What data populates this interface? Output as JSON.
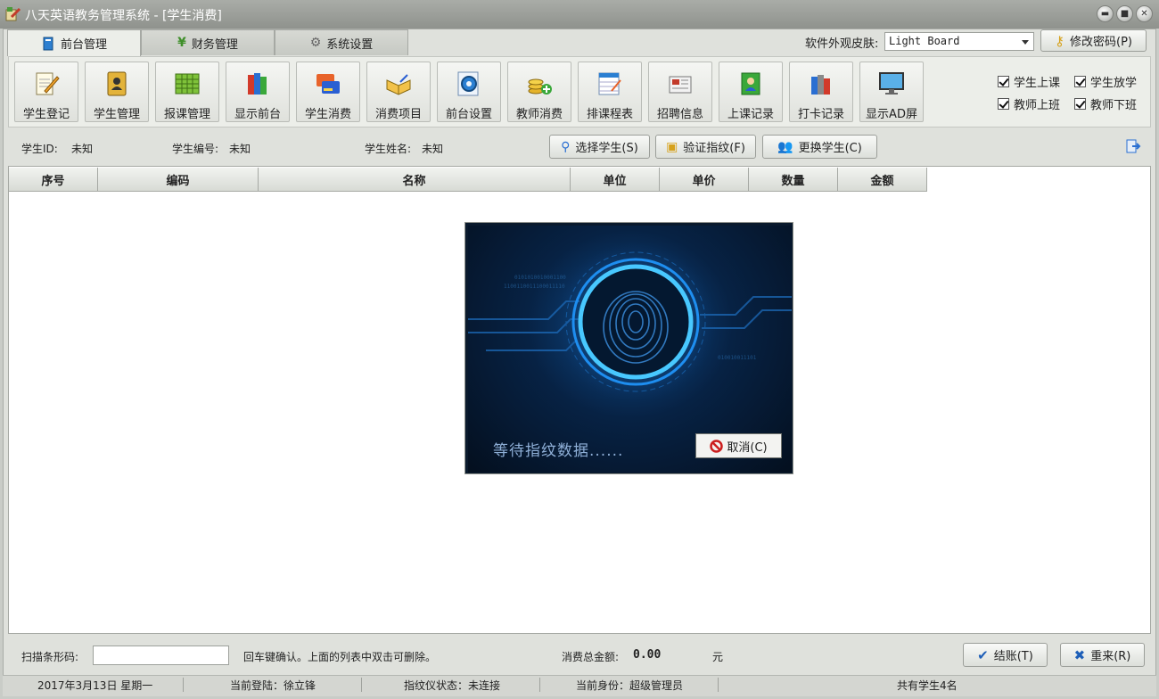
{
  "window": {
    "title": "八天英语教务管理系统 - [学生消费]"
  },
  "tabs": [
    {
      "label": "前台管理",
      "icon": "book-icon",
      "active": true
    },
    {
      "label": "财务管理",
      "icon": "yen-icon",
      "active": false
    },
    {
      "label": "系统设置",
      "icon": "gear-icon",
      "active": false
    }
  ],
  "skin": {
    "label": "软件外观皮肤:",
    "value": "Light Board"
  },
  "change_password": {
    "label": "修改密码(P)"
  },
  "toolbar": [
    {
      "label": "学生登记",
      "icon": "notepad-pencil-icon"
    },
    {
      "label": "学生管理",
      "icon": "contact-book-icon"
    },
    {
      "label": "报课管理",
      "icon": "spreadsheet-icon"
    },
    {
      "label": "显示前台",
      "icon": "books-icon"
    },
    {
      "label": "学生消费",
      "icon": "credit-card-icon"
    },
    {
      "label": "消费项目",
      "icon": "open-book-icon"
    },
    {
      "label": "前台设置",
      "icon": "settings-gear-icon"
    },
    {
      "label": "教师消费",
      "icon": "coins-add-icon"
    },
    {
      "label": "排课程表",
      "icon": "schedule-icon"
    },
    {
      "label": "招聘信息",
      "icon": "newspaper-icon"
    },
    {
      "label": "上课记录",
      "icon": "class-record-icon"
    },
    {
      "label": "打卡记录",
      "icon": "punch-books-icon"
    },
    {
      "label": "显示AD屏",
      "icon": "monitor-icon"
    }
  ],
  "checkboxes": [
    {
      "label": "学生上课",
      "checked": true
    },
    {
      "label": "学生放学",
      "checked": true
    },
    {
      "label": "教师上班",
      "checked": true
    },
    {
      "label": "教师下班",
      "checked": true
    }
  ],
  "student_info": {
    "id_label": "学生ID:",
    "id_value": "未知",
    "no_label": "学生编号:",
    "no_value": "未知",
    "name_label": "学生姓名:",
    "name_value": "未知"
  },
  "actions": {
    "select_student": "选择学生(S)",
    "verify_fingerprint": "验证指纹(F)",
    "change_student": "更换学生(C)"
  },
  "table": {
    "headers": [
      "序号",
      "编码",
      "名称",
      "单位",
      "单价",
      "数量",
      "金额"
    ],
    "rows": []
  },
  "fingerprint_dialog": {
    "message": "等待指纹数据......",
    "cancel_label": "取消(C)"
  },
  "footer": {
    "scan_label": "扫描条形码:",
    "scan_value": "",
    "hint": "回车键确认。上面的列表中双击可删除。",
    "total_label": "消费总金额:",
    "total_value": "0.00",
    "currency": "元",
    "checkout_label": "结账(T)",
    "reset_label": "重来(R)"
  },
  "status": {
    "date": "2017年3月13日 星期一",
    "login": "当前登陆：徐立锋",
    "device": "指纹仪状态：未连接",
    "identity": "当前身份：超级管理员",
    "count": "共有学生4名"
  },
  "colors": {
    "accent_blue": "#1e7bd6",
    "fingerprint_bg": "#072244",
    "cancel_red": "#cc1f1f"
  }
}
